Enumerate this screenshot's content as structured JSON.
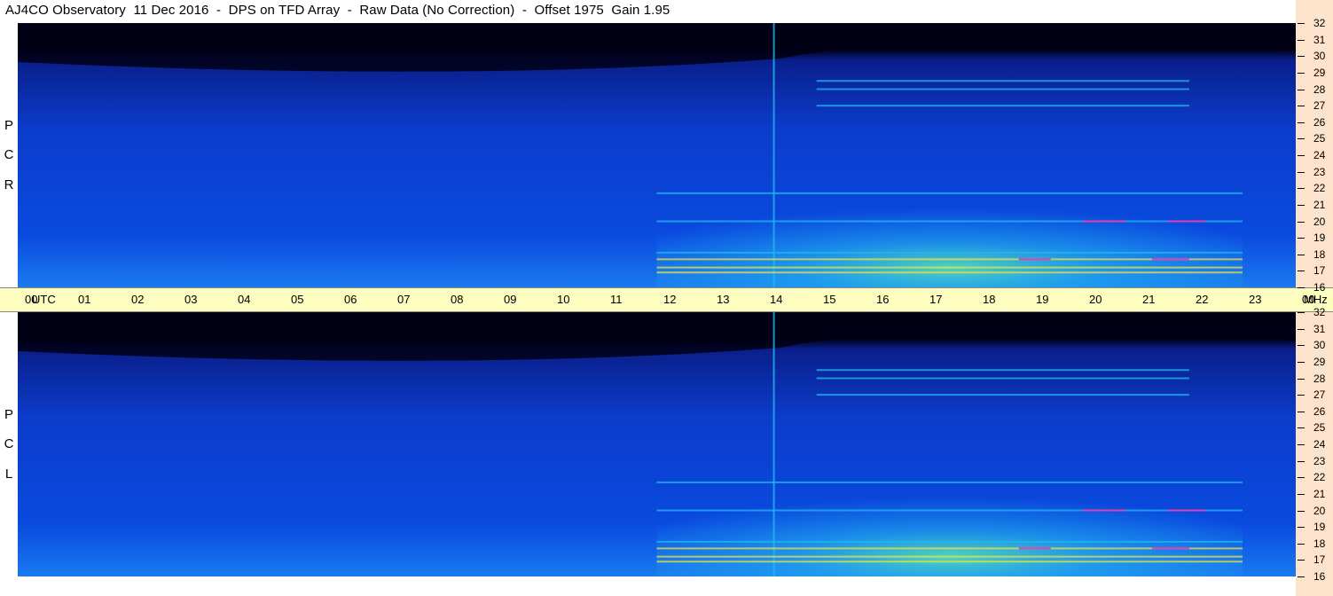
{
  "title": "AJ4CO Observatory  11 Dec 2016  -  DPS on TFD Array  -  Raw Data (No Correction)  -  Offset 1975  Gain 1.95",
  "colors": {
    "background": "#ffffff",
    "time_axis_bg": "#fdfdc0",
    "freq_strip_bg": "#fde3cb",
    "spectro_dark": "#000014",
    "spectro_blue": "#0a4adf",
    "spectro_cyan": "#22b8f0",
    "spectro_green": "#5ef0b0",
    "spectro_yellow": "#f0e040",
    "spectro_magenta": "#e040b0"
  },
  "chart_data": {
    "type": "heatmap",
    "title": "AJ4CO Observatory  11 Dec 2016  -  DPS on TFD Array  -  Raw Data (No Correction)  -  Offset 1975  Gain 1.95",
    "x_axis": {
      "label": "UTC",
      "unit_first": "UTC",
      "ticks": [
        "00",
        "01",
        "02",
        "03",
        "04",
        "05",
        "06",
        "07",
        "08",
        "09",
        "10",
        "11",
        "12",
        "13",
        "14",
        "15",
        "16",
        "17",
        "18",
        "19",
        "20",
        "21",
        "22",
        "23",
        "00"
      ],
      "range": [
        0,
        24
      ]
    },
    "y_axis": {
      "unit": "MHz",
      "ticks": [
        32,
        31,
        30,
        29,
        28,
        27,
        26,
        25,
        24,
        23,
        22,
        21,
        20,
        19,
        18,
        17,
        16
      ],
      "range": [
        16,
        32
      ]
    },
    "panels": [
      {
        "name": "RCP",
        "polarization_letters": [
          "R",
          "C",
          "P"
        ]
      },
      {
        "name": "LCP",
        "polarization_letters": [
          "L",
          "C",
          "P"
        ]
      }
    ],
    "features": [
      {
        "type": "narrowband_lines",
        "freq_mhz": [
          27,
          28,
          28.5
        ],
        "utc_range": [
          15,
          22
        ]
      },
      {
        "type": "narrowband_lines",
        "freq_mhz": [
          16.9,
          17.2,
          17.7,
          18.1,
          20,
          21.7
        ],
        "utc_range": [
          12,
          23
        ]
      },
      {
        "type": "broadband_vertical",
        "utc": 14.2
      },
      {
        "type": "day_enhancement",
        "utc_range": [
          12,
          23
        ],
        "freq_range": [
          16,
          22
        ]
      }
    ],
    "grid": false,
    "legend": "none"
  }
}
